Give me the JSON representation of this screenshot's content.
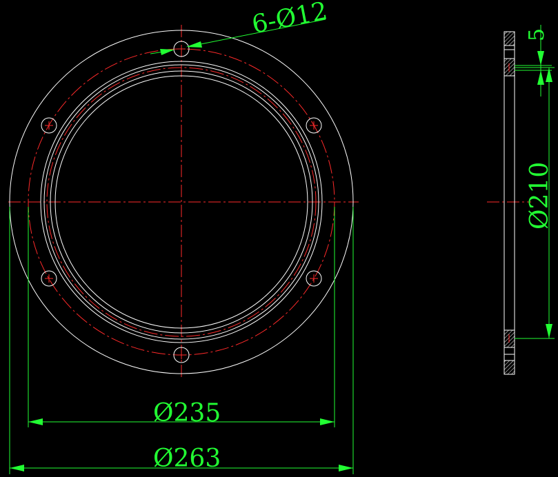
{
  "drawing": {
    "hole_callout": "6-Ø12",
    "dim_bolt_circle": "Ø235",
    "dim_outer": "Ø263",
    "dim_inner": "Ø210",
    "dim_thickness": "5"
  },
  "colors": {
    "background": "#000000",
    "geometry": "#ffffff",
    "centerline": "#ff2a2a",
    "dimension": "#22ff33"
  }
}
